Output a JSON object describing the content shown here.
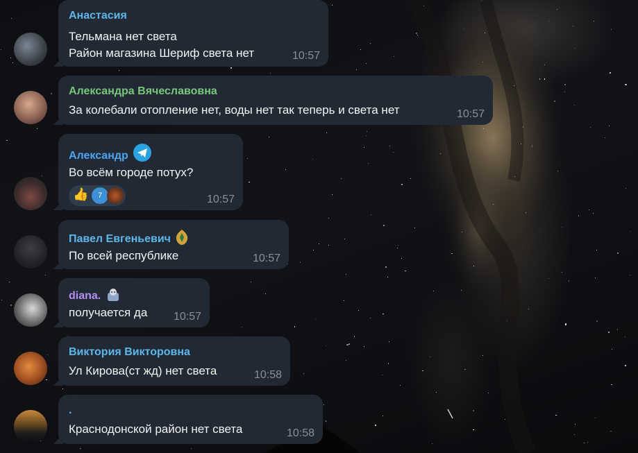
{
  "messages": [
    {
      "author": "Анастасия",
      "author_color": "#5fb6e8",
      "lines": [
        "Тельмана нет света",
        "Район магазина Шериф света нет"
      ],
      "time": "10:57"
    },
    {
      "author": "Александра Вячеславовна",
      "author_color": "#79c77c",
      "lines": [
        "За колебали отопление нет, воды нет так теперь и света нет"
      ],
      "time": "10:57"
    },
    {
      "author": "Александр",
      "author_color": "#4ea4f0",
      "lines": [
        "Во всём городе потух?"
      ],
      "time": "10:57",
      "reactions": {
        "emoji": "👍",
        "count": "7"
      }
    },
    {
      "author": "Павел Евгеньевич",
      "author_color": "#5fb6e8",
      "lines": [
        "По всей республике"
      ],
      "time": "10:57"
    },
    {
      "author": "diana.",
      "author_color": "#b48ef2",
      "lines": [
        "получается да"
      ],
      "time": "10:57"
    },
    {
      "author": "Виктория Викторовна",
      "author_color": "#5fb6e8",
      "lines": [
        "Ул Кирова(ст жд) нет света"
      ],
      "time": "10:58"
    },
    {
      "author": ".",
      "author_color": "#5fb6e8",
      "lines": [
        "Краснодонской район нет света"
      ],
      "time": "10:58"
    }
  ]
}
